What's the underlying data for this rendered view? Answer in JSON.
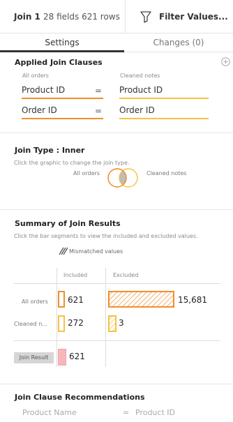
{
  "header": {
    "join_title": "Join 1",
    "fields": "28 fields",
    "rows": "621 rows",
    "filter_label": "Filter Values..."
  },
  "tabs": [
    {
      "label": "Settings",
      "active": true
    },
    {
      "label": "Changes (0)",
      "active": false
    }
  ],
  "applied": {
    "title": "Applied Join Clauses",
    "left_source": "All orders",
    "right_source": "Cleaned notes",
    "clauses": [
      {
        "left": "Product ID",
        "op": "=",
        "right": "Product ID"
      },
      {
        "left": "Order ID",
        "op": "=",
        "right": "Order ID"
      }
    ]
  },
  "join_type": {
    "title": "Join Type : Inner",
    "help": "Click the graphic to change the join type.",
    "left": "All orders",
    "right": "Cleaned notes"
  },
  "summary": {
    "title": "Summary of Join Results",
    "help": "Click the bar segments to view the included and excluded values.",
    "legend_mismatched": "Mismatched values",
    "col_included": "Included",
    "col_excluded": "Excluded",
    "rows": [
      {
        "label": "All orders",
        "included": "621",
        "excluded": "15,681"
      },
      {
        "label": "Cleaned n...",
        "included": "272",
        "excluded": "3"
      }
    ],
    "result_label": "Join Result",
    "result_value": "621"
  },
  "recommendations": {
    "title": "Join Clause Recommendations",
    "items": [
      {
        "left": "Product Name",
        "op": "=",
        "right": "Product ID"
      }
    ]
  },
  "colors": {
    "orange": "#f28e2b",
    "yellow": "#f5c242",
    "pink": "#f4a3a8",
    "result_fill": "#f7b6bb"
  }
}
